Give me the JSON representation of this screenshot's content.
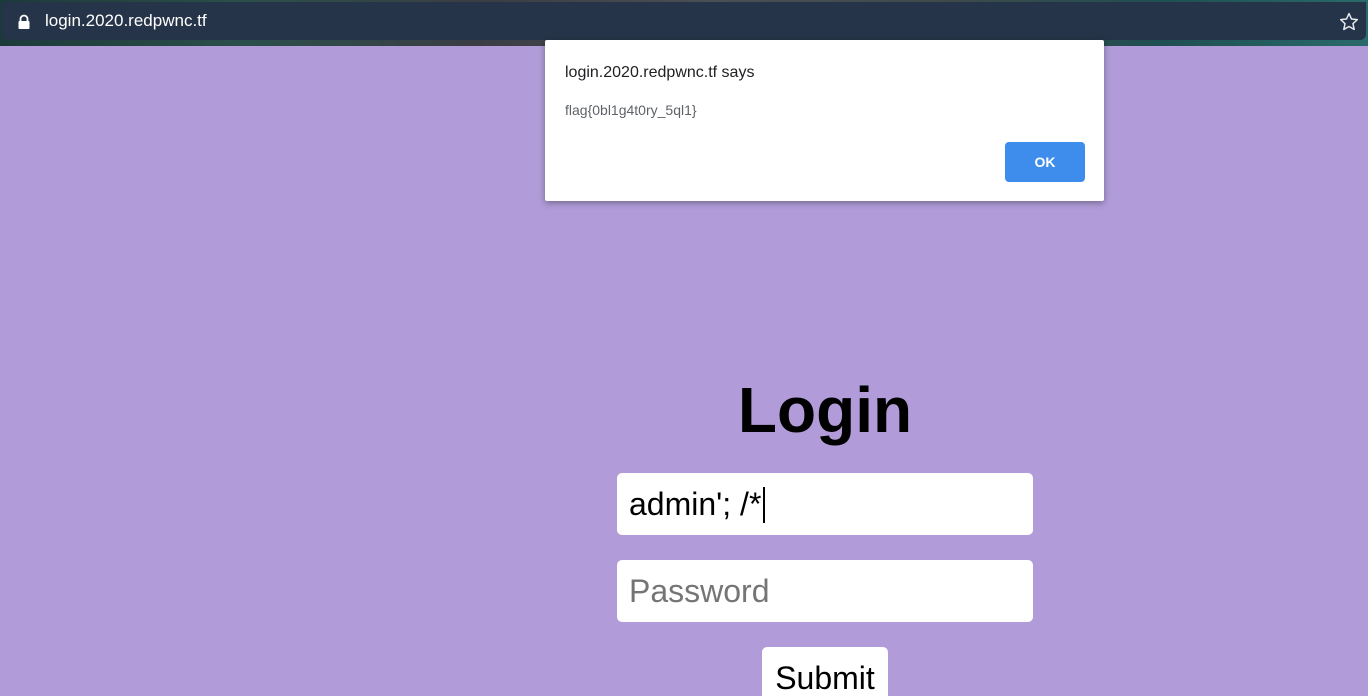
{
  "browser": {
    "url": "login.2020.redpwnc.tf",
    "icons": [
      "lock-icon",
      "bookmark-star-icon"
    ]
  },
  "alert": {
    "title": "login.2020.redpwnc.tf says",
    "message": "flag{0bl1g4t0ry_5ql1}",
    "ok_label": "OK"
  },
  "login": {
    "heading": "Login",
    "username_value": "admin'; /*",
    "password_placeholder": "Password",
    "submit_label": "Submit"
  },
  "colors": {
    "page_background": "#b19cd9",
    "ok_button": "#3e8ded",
    "address_bar": "#263449"
  }
}
